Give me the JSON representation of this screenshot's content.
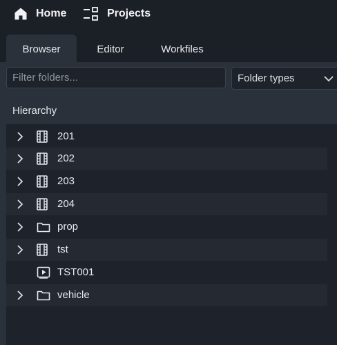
{
  "topnav": {
    "home_label": "Home",
    "projects_label": "Projects"
  },
  "tabs": [
    {
      "label": "Browser",
      "active": true
    },
    {
      "label": "Editor",
      "active": false
    },
    {
      "label": "Workfiles",
      "active": false
    }
  ],
  "filter": {
    "placeholder": "Filter folders...",
    "value": ""
  },
  "folder_types": {
    "label": "Folder types"
  },
  "hierarchy": {
    "header": "Hierarchy",
    "items": [
      {
        "label": "201",
        "icon": "film-strip-icon",
        "expandable": true
      },
      {
        "label": "202",
        "icon": "film-strip-icon",
        "expandable": true
      },
      {
        "label": "203",
        "icon": "film-strip-icon",
        "expandable": true
      },
      {
        "label": "204",
        "icon": "film-strip-icon",
        "expandable": true
      },
      {
        "label": "prop",
        "icon": "folder-icon",
        "expandable": true
      },
      {
        "label": "tst",
        "icon": "film-strip-icon",
        "expandable": true
      },
      {
        "label": "TST001",
        "icon": "shot-play-icon",
        "expandable": false
      },
      {
        "label": "vehicle",
        "icon": "folder-icon",
        "expandable": true
      }
    ]
  },
  "colors": {
    "background": "#1b1f26",
    "panel": "#2a313a",
    "tree_background": "#1e232b",
    "text": "#e6e9ee"
  }
}
